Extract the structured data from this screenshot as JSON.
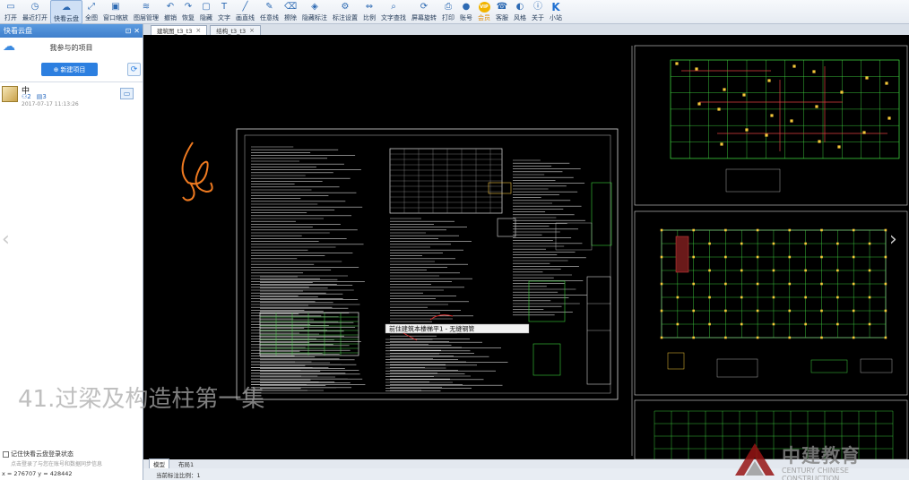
{
  "toolbar": [
    {
      "label": "打开",
      "icon": "open-icon",
      "glyph": "▭"
    },
    {
      "label": "最近打开",
      "icon": "recent-icon",
      "glyph": "◷"
    },
    {
      "label": "快看云盘",
      "icon": "cloud-icon",
      "glyph": "☁"
    },
    {
      "label": "全图",
      "icon": "fit-icon",
      "glyph": "⤢"
    },
    {
      "label": "窗口缩放",
      "icon": "zoom-window-icon",
      "glyph": "▣"
    },
    {
      "label": "图层管理",
      "icon": "layers-icon",
      "glyph": "≋"
    },
    {
      "label": "撤销",
      "icon": "undo-icon",
      "glyph": "↶"
    },
    {
      "label": "恢复",
      "icon": "redo-icon",
      "glyph": "↷"
    },
    {
      "label": "隐藏",
      "icon": "hide-icon",
      "glyph": "▢"
    },
    {
      "label": "文字",
      "icon": "text-icon",
      "glyph": "T"
    },
    {
      "label": "画直线",
      "icon": "line-icon",
      "glyph": "╱"
    },
    {
      "label": "任意线",
      "icon": "pen-icon",
      "glyph": "✎"
    },
    {
      "label": "擦除",
      "icon": "eraser-icon",
      "glyph": "⌫"
    },
    {
      "label": "隐藏标注",
      "icon": "hide-markup-icon",
      "glyph": "◈"
    },
    {
      "label": "标注设置",
      "icon": "markup-settings-icon",
      "glyph": "⚙"
    },
    {
      "label": "比例",
      "icon": "scale-icon",
      "glyph": "⇔"
    },
    {
      "label": "文字查找",
      "icon": "find-text-icon",
      "glyph": "⌕"
    },
    {
      "label": "屏幕旋转",
      "icon": "rotate-icon",
      "glyph": "⟳"
    },
    {
      "label": "打印",
      "icon": "print-icon",
      "glyph": "⎙"
    },
    {
      "label": "账号",
      "icon": "account-icon",
      "glyph": "●"
    },
    {
      "label": "会员",
      "icon": "vip-icon",
      "glyph": "VIP"
    },
    {
      "label": "客服",
      "icon": "support-icon",
      "glyph": "☎"
    },
    {
      "label": "风格",
      "icon": "style-icon",
      "glyph": "◐"
    },
    {
      "label": "关于",
      "icon": "about-icon",
      "glyph": "ⓘ"
    },
    {
      "label": "小站",
      "icon": "brand-icon",
      "glyph": "K"
    }
  ],
  "panel": {
    "title": "快看云盘",
    "section_title": "我参与的项目",
    "new_project_label": "新建项目",
    "projects": [
      {
        "name": "中",
        "members": "2",
        "files": "3",
        "date": "2017-07-17 11:13:26"
      }
    ],
    "sync_label": "记住快看云盘登录状态",
    "sync_hint": "点击登录了与您在账号和数据同步信息"
  },
  "tabs": [
    {
      "label": "建筑图_t3_t3",
      "active": true
    },
    {
      "label": "结构_t3_t3",
      "active": false
    }
  ],
  "layout_tabs": [
    "模型",
    "布局1"
  ],
  "status": {
    "scale_text": "当前标注比例：1",
    "coords": "x = 276707 y = 428442"
  },
  "drawing_annotation": "前住建筑本楼梯平1 - 无缝钢管",
  "overlay_title": "41.过梁及构造柱第一集",
  "watermark": {
    "cn": "中建教育",
    "en": "CENTURY CHINESE CONSTRUCTION"
  },
  "colors": {
    "accent": "#2c7fe0",
    "panel_header": "#4a8ad6",
    "canvas": "#000000"
  }
}
